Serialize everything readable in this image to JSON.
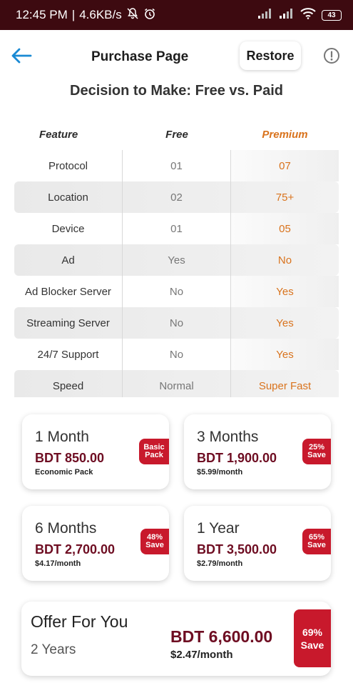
{
  "status_bar": {
    "time": "12:45 PM",
    "separator": "|",
    "network_speed": "4.6KB/s",
    "battery": "43",
    "icons": [
      "mute-icon",
      "alarm-icon",
      "signal-icon",
      "signal-icon",
      "wifi-icon",
      "battery-icon"
    ]
  },
  "header": {
    "title": "Purchase Page",
    "restore_label": "Restore",
    "back_icon": "arrow-left-icon",
    "info_icon": "info-icon",
    "accent_color": "#1a8ad4"
  },
  "comparison": {
    "title": "Decision to Make: Free vs. Paid",
    "columns": [
      "Feature",
      "Free",
      "Premium"
    ],
    "rows": [
      {
        "feature": "Protocol",
        "free": "01",
        "premium": "07"
      },
      {
        "feature": "Location",
        "free": "02",
        "premium": "75+"
      },
      {
        "feature": "Device",
        "free": "01",
        "premium": "05"
      },
      {
        "feature": "Ad",
        "free": "Yes",
        "premium": "No"
      },
      {
        "feature": "Ad Blocker Server",
        "free": "No",
        "premium": "Yes"
      },
      {
        "feature": "Streaming Server",
        "free": "No",
        "premium": "Yes"
      },
      {
        "feature": "24/7 Support",
        "free": "No",
        "premium": "Yes"
      },
      {
        "feature": "Speed",
        "free": "Normal",
        "premium": "Super Fast"
      }
    ],
    "premium_color": "#d9731d"
  },
  "plans": [
    {
      "duration": "1 Month",
      "price": "BDT 850.00",
      "sub": "Economic Pack",
      "badge_line1": "Basic",
      "badge_line2": "Pack"
    },
    {
      "duration": "3 Months",
      "price": "BDT 1,900.00",
      "sub": "$5.99/month",
      "badge_line1": "25%",
      "badge_line2": "Save"
    },
    {
      "duration": "6 Months",
      "price": "BDT 2,700.00",
      "sub": "$4.17/month",
      "badge_line1": "48%",
      "badge_line2": "Save"
    },
    {
      "duration": "1 Year",
      "price": "BDT 3,500.00",
      "sub": "$2.79/month",
      "badge_line1": "65%",
      "badge_line2": "Save"
    }
  ],
  "offer": {
    "title": "Offer For You",
    "duration": "2 Years",
    "price": "BDT 6,600.00",
    "sub": "$2.47/month",
    "badge_line1": "69%",
    "badge_line2": "Save"
  },
  "colors": {
    "status_bar": "#3d0a10",
    "price": "#6e0d22",
    "badge": "#c8192c"
  }
}
